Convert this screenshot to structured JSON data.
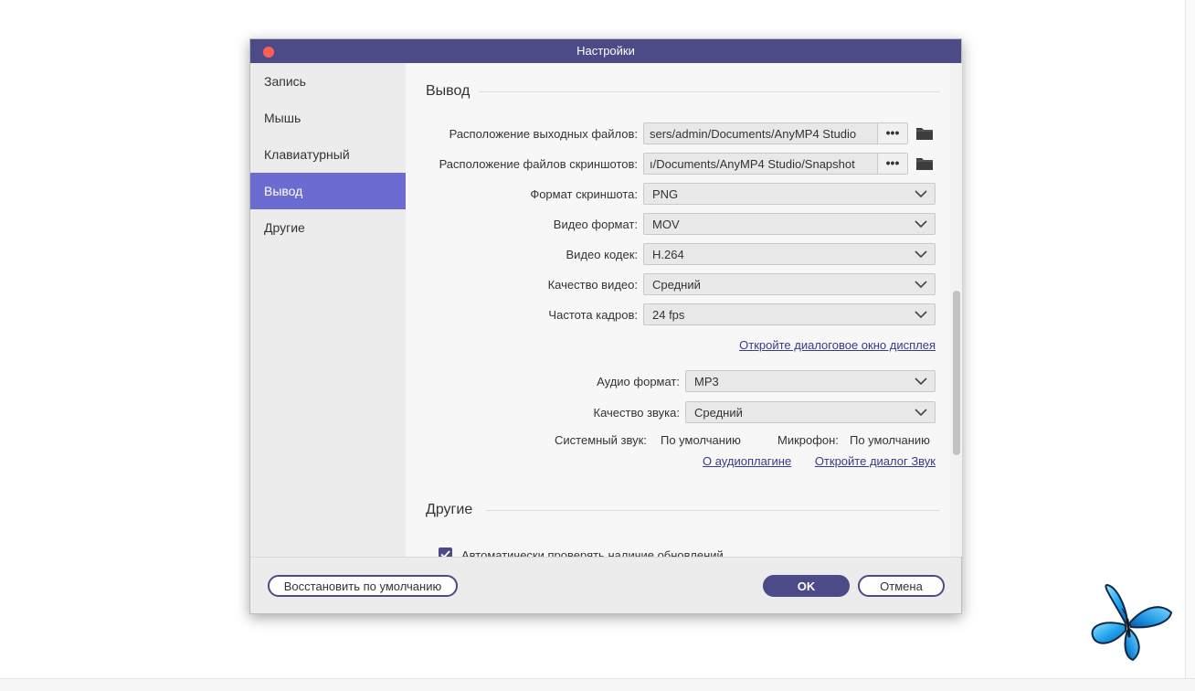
{
  "dialog": {
    "title": "Настройки",
    "accent_color": "#4c4a87",
    "active_color": "#6c6bd1"
  },
  "sidebar": {
    "items": [
      {
        "label": "Запись"
      },
      {
        "label": "Мышь"
      },
      {
        "label": "Клавиатурный"
      },
      {
        "label": "Вывод",
        "active": true
      },
      {
        "label": "Другие"
      }
    ]
  },
  "output": {
    "section_title": "Вывод",
    "output_location_label": "Расположение выходных файлов:",
    "output_location_value": "sers/admin/Documents/AnyMP4 Studio",
    "screenshot_location_label": "Расположение файлов скриншотов:",
    "screenshot_location_value": "ı/Documents/AnyMP4 Studio/Snapshot",
    "more_glyph": "•••",
    "screenshot_format_label": "Формат скриншота:",
    "screenshot_format_value": "PNG",
    "video_format_label": "Видео формат:",
    "video_format_value": "MOV",
    "video_codec_label": "Видео кодек:",
    "video_codec_value": "H.264",
    "video_quality_label": "Качество видео:",
    "video_quality_value": "Средний",
    "frame_rate_label": "Частота кадров:",
    "frame_rate_value": "24 fps",
    "display_dialog_link": "Откройте диалоговое окно дисплея",
    "audio_format_label": "Аудио формат:",
    "audio_format_value": "MP3",
    "audio_quality_label": "Качество звука:",
    "audio_quality_value": "Средний",
    "system_sound_label": "Системный звук:",
    "system_sound_value": "По умолчанию",
    "microphone_label": "Микрофон:",
    "microphone_value": "По умолчанию",
    "audio_plugin_link": "О аудиоплагине",
    "sound_dialog_link": "Откройте диалог Звук"
  },
  "other": {
    "section_title": "Другие",
    "auto_update_label": "Автоматически проверять наличие обновлений",
    "auto_update_checked": true
  },
  "footer": {
    "restore_label": "Восстановить по умолчанию",
    "ok_label": "OK",
    "cancel_label": "Отмена"
  },
  "icons": {
    "folder": "folder-icon",
    "chevron": "chevron-down-icon",
    "check": "checkmark-icon",
    "close": "close-dot-icon",
    "butterfly": "butterfly-logo"
  }
}
